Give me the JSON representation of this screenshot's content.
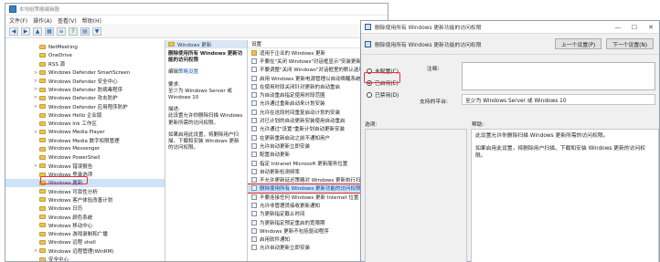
{
  "editor": {
    "title": "本地组策略编辑器",
    "menus": [
      "文件(F)",
      "操作(A)",
      "查看(V)",
      "帮助(H)"
    ],
    "tree": [
      {
        "label": "NetMeeting",
        "arrow": ""
      },
      {
        "label": "OneDrive",
        "arrow": ""
      },
      {
        "label": "RSS 源",
        "arrow": ""
      },
      {
        "label": "Windows Defender SmartScreen",
        "arrow": ">"
      },
      {
        "label": "Windows Defender 安全中心",
        "arrow": ">"
      },
      {
        "label": "Windows Defender 防病毒程序",
        "arrow": ">"
      },
      {
        "label": "Windows Defender 攻击防护",
        "arrow": ">"
      },
      {
        "label": "Windows Defender 应用程序防护",
        "arrow": ">"
      },
      {
        "label": "Windows Hello 企业版",
        "arrow": ""
      },
      {
        "label": "Windows Ink 工作区",
        "arrow": ""
      },
      {
        "label": "Windows Media Player",
        "arrow": ">"
      },
      {
        "label": "Windows Media 数字权限管理",
        "arrow": ""
      },
      {
        "label": "Windows Messenger",
        "arrow": ""
      },
      {
        "label": "Windows PowerShell",
        "arrow": ""
      },
      {
        "label": "Windows 错误报告",
        "arrow": ">"
      },
      {
        "label": "Windows 登录选项",
        "arrow": ""
      },
      {
        "label": "Windows 更新",
        "arrow": "",
        "selected": true
      },
      {
        "label": "Windows 可靠性分析",
        "arrow": ""
      },
      {
        "label": "Windows 客户体验改善计划",
        "arrow": ""
      },
      {
        "label": "Windows 日历",
        "arrow": ""
      },
      {
        "label": "Windows 颜色系统",
        "arrow": ""
      },
      {
        "label": "Windows 移动中心",
        "arrow": ""
      },
      {
        "label": "Windows 游戏录制和广播",
        "arrow": ""
      },
      {
        "label": "Windows 远程 shell",
        "arrow": ""
      },
      {
        "label": "Windows 远程管理(WinRM)",
        "arrow": ">"
      },
      {
        "label": "安全中心",
        "arrow": ""
      }
    ],
    "desc": {
      "header": "Windows 更新",
      "title": "删除使用所有 Windows 更新功能的访问权限",
      "edit_prefix": "编辑",
      "edit_link": "策略设置",
      "requirement_label": "要求:",
      "requirement": "至少为 Windows Server 或 Windows 10",
      "desc_label": "描述:",
      "desc_text": "此设置允许你删除扫描 Windows 更新所需的访问权限。",
      "desc_text2": "如果启用此设置，将删除用户扫描、下载和安装 Windows 更新的访问权限。"
    },
    "settings_header": "设置",
    "settings": [
      {
        "label": "适用于企业的 Windows 更新",
        "folder": true
      },
      {
        "label": "不要在\"关闭 Windows\"对话框显示\"安装更新并关机\""
      },
      {
        "label": "不要调整\"关闭 Windows\"对话框里的默认选项"
      },
      {
        "label": "启用 Windows 更新电源管理以自动唤醒系统来安装..."
      },
      {
        "label": "在使用时段关闭针对更新的自动重启"
      },
      {
        "label": "为自动重启指定使用时段范围"
      },
      {
        "label": "允许通过重新启动来计划安装"
      },
      {
        "label": "允许在这段时间重复启动计划的安装"
      },
      {
        "label": "对已计划的自动更新安装使用自动重启"
      },
      {
        "label": "允许通过\"设置\"重新计划自动更新安装"
      },
      {
        "label": "在更新重新启动之前不通知用户"
      },
      {
        "label": "允许自动更新立即安装"
      },
      {
        "label": "配置自动更新"
      },
      {
        "label": "指定 Intranet Microsoft 更新服务位置"
      },
      {
        "label": "自动更新检测频率"
      },
      {
        "label": "不允许更新延迟策略对 Windows 更新执行扫描"
      },
      {
        "label": "删除使用所有 Windows 更新功能的访问权限",
        "selected": true
      },
      {
        "label": "不要连接任何 Windows 更新 Internet 位置"
      },
      {
        "label": "允许非管理员接收更新通知"
      },
      {
        "label": "为更新指定截止时间"
      },
      {
        "label": "为更新指定预定重启的宽限期"
      },
      {
        "label": "Windows 更新不包括驱动程序"
      },
      {
        "label": "启用软件通知"
      },
      {
        "label": "允许自动更新立即安装"
      }
    ]
  },
  "dialog": {
    "title": "删除使用所有 Windows 更新功能的访问权限",
    "subtitle": "删除使用所有 Windows 更新功能的访问权限",
    "prev_btn": "上一个设置(P)",
    "next_btn": "下一个设置(N)",
    "radios": [
      {
        "label": "未配置(C)",
        "checked": false
      },
      {
        "label": "已启用(E)",
        "checked": true
      },
      {
        "label": "已禁用(D)",
        "checked": false
      }
    ],
    "note_label": "注释:",
    "supported_label": "支持的平台:",
    "supported_value": "至少为 Windows Server 或 Windows 10",
    "options_label": "选项:",
    "help_label": "帮助:",
    "help_p1": "此设置允许你删除扫描 Windows 更新所需的访问权限。",
    "help_p2": "如果启用此设置，将删除用户扫描、下载和安装 Windows 更新的访问权限。"
  },
  "colors": {
    "selection": "#cde3f7",
    "highlight_red": "#e33333",
    "link": "#1a5fb4"
  }
}
